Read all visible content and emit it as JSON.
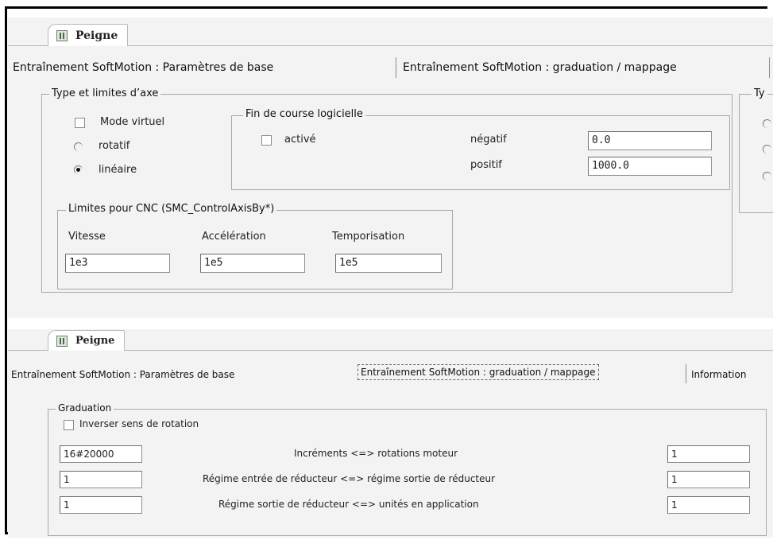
{
  "top_panel": {
    "doc_tab_label": "Peigne",
    "subtabs": [
      "Entraînement SoftMotion : Paramètres de base",
      "Entraînement SoftMotion : graduation / mappage"
    ],
    "axis_group": {
      "title": "Type et limites d’axe",
      "virtual_mode_label": "Mode virtuel",
      "rotary_label": "rotatif",
      "linear_label": "linéaire",
      "selected_type": "linéaire"
    },
    "software_limits": {
      "title": "Fin de course logicielle",
      "enabled_label": "activé",
      "negative_label": "négatif",
      "negative_value": "0.0",
      "positive_label": "positif",
      "positive_value": "1000.0"
    },
    "cnc_limits": {
      "title": "Limites pour CNC (SMC_ControlAxisBy*)",
      "velocity_label": "Vitesse",
      "velocity_value": "1e3",
      "acceleration_label": "Accélération",
      "acceleration_value": "1e5",
      "delay_label": "Temporisation",
      "delay_value": "1e5"
    },
    "right_group_partial_title": "Ty"
  },
  "bottom_panel": {
    "doc_tab_label": "Peigne",
    "subtabs": [
      "Entraînement SoftMotion : Paramètres de base",
      "Entraînement SoftMotion : graduation / mappage",
      "Information"
    ],
    "graduation": {
      "title": "Graduation",
      "invert_label": "Inverser sens de rotation",
      "rows": [
        {
          "left": "16#20000",
          "label": "Incréments <=> rotations moteur",
          "right": "1"
        },
        {
          "left": "1",
          "label": "Régime entrée de réducteur <=> régime sortie de réducteur",
          "right": "1"
        },
        {
          "left": "1",
          "label": "Régime sortie de réducteur <=> unités en application",
          "right": "1"
        }
      ]
    }
  }
}
